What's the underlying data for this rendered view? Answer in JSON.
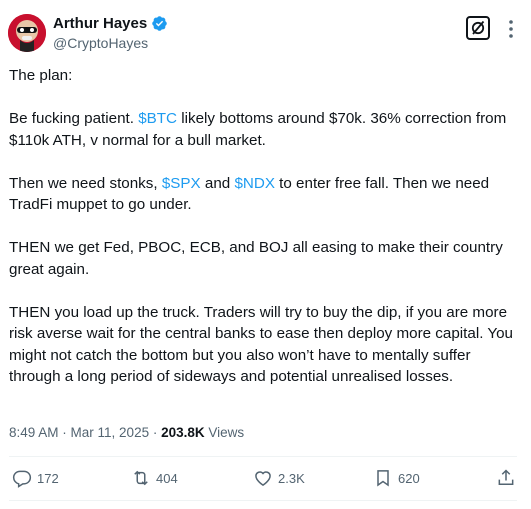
{
  "author": {
    "display_name": "Arthur Hayes",
    "handle": "@CryptoHayes",
    "verified_icon": "verified-badge-icon",
    "avatar_color": "#c8102e"
  },
  "tweet": {
    "p1": "The plan:",
    "p2_a": "Be fucking patient. ",
    "p2_tag": "$BTC",
    "p2_b": " likely bottoms around $70k. 36% correction from $110k ATH, v normal for a bull market.",
    "p3_a": "Then we need stonks, ",
    "p3_tag1": "$SPX",
    "p3_mid": " and ",
    "p3_tag2": "$NDX",
    "p3_b": " to enter free fall. Then we need TradFi muppet to go under.",
    "p4": "THEN we get Fed, PBOC, ECB, and BOJ all easing to make their country great again.",
    "p5": "THEN you load up the truck. Traders will try to buy the dip, if you are more risk averse wait for the central banks to ease then deploy more capital. You might not catch the bottom but you also won’t have to mentally suffer through a long period of sideways and potential unrealised losses."
  },
  "meta": {
    "time": "8:49 AM",
    "sep": " · ",
    "date": "Mar 11, 2025",
    "views_count": "203.8K",
    "views_label": " Views"
  },
  "actions": {
    "replies": "172",
    "reposts": "404",
    "likes": "2.3K",
    "bookmarks": "620"
  },
  "colors": {
    "accent": "#1d9bf0",
    "text": "#0f1419",
    "muted": "#536471"
  }
}
